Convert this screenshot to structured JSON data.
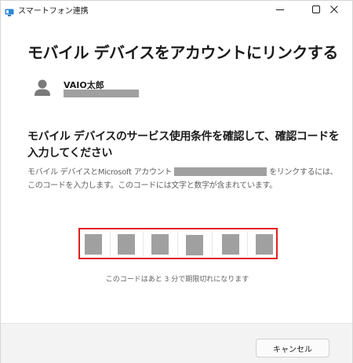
{
  "window": {
    "title": "スマートフォン連携"
  },
  "page": {
    "heading": "モバイル デバイスをアカウントにリンクする"
  },
  "account": {
    "name": "VAIO太郎"
  },
  "instructions": {
    "title": "モバイル デバイスのサービス使用条件を確認して、確認コードを入力してください",
    "body_before": "モバイル デバイスとMicrosoft アカウント",
    "body_after": "をリンクするには、このコードを入力します。このコードには文字と数字が含まれています。"
  },
  "code": {
    "expiry": "このコードはあと 3 分で期限切れになります"
  },
  "footer": {
    "cancel_label": "キャンセル"
  },
  "colors": {
    "highlight": "#e0201f",
    "redaction": "#a0a0a0",
    "footer_bg": "#f3f3f3"
  },
  "icons": {
    "app": "phone-link-icon",
    "avatar": "person-icon"
  }
}
